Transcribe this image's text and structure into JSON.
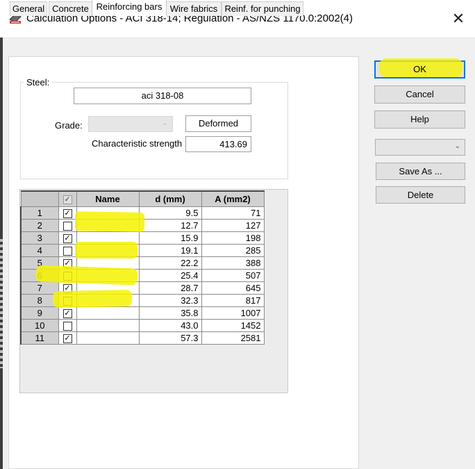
{
  "window": {
    "title": "Calculation Options - ACI 318-14;   Regulation - AS/NZS 1170.0:2002(4)",
    "close_glyph": "✕"
  },
  "tabs": [
    {
      "label": "General"
    },
    {
      "label": "Concrete"
    },
    {
      "label": "Reinforcing bars",
      "active": true
    },
    {
      "label": "Wire fabrics"
    },
    {
      "label": "Reinf. for punching"
    }
  ],
  "steel": {
    "group_label": "Steel:",
    "name_value": "aci 318-08",
    "grade_label": "Grade:",
    "grade_value": "",
    "bar_type": "Deformed",
    "strength_label": "Characteristic strength",
    "strength_value": "413.69"
  },
  "grid": {
    "headers": {
      "name": "Name",
      "d": "d (mm)",
      "a": "A (mm2)"
    },
    "rows": [
      {
        "n": "1",
        "checked": true,
        "name": "",
        "d": "9.5",
        "a": "71"
      },
      {
        "n": "2",
        "checked": false,
        "name": "",
        "d": "12.7",
        "a": "127"
      },
      {
        "n": "3",
        "checked": true,
        "name": "",
        "d": "15.9",
        "a": "198"
      },
      {
        "n": "4",
        "checked": false,
        "name": "",
        "d": "19.1",
        "a": "285"
      },
      {
        "n": "5",
        "checked": true,
        "name": "",
        "d": "22.2",
        "a": "388"
      },
      {
        "n": "6",
        "checked": false,
        "name": "",
        "d": "25.4",
        "a": "507"
      },
      {
        "n": "7",
        "checked": true,
        "name": "",
        "d": "28.7",
        "a": "645"
      },
      {
        "n": "8",
        "checked": false,
        "name": "",
        "d": "32.3",
        "a": "817"
      },
      {
        "n": "9",
        "checked": true,
        "name": "",
        "d": "35.8",
        "a": "1007"
      },
      {
        "n": "10",
        "checked": false,
        "name": "",
        "d": "43.0",
        "a": "1452"
      },
      {
        "n": "11",
        "checked": true,
        "name": "",
        "d": "57.3",
        "a": "2581"
      }
    ]
  },
  "buttons": {
    "ok": "OK",
    "cancel": "Cancel",
    "help": "Help",
    "save_as": "Save As ...",
    "delete": "Delete",
    "combo_value": ""
  },
  "colors": {
    "highlight": "#f6f200",
    "default_button_border": "#0078d7"
  },
  "icons": {
    "app": "app-icon",
    "check": "check-icon",
    "dropdown": "chevron-down-icon"
  }
}
